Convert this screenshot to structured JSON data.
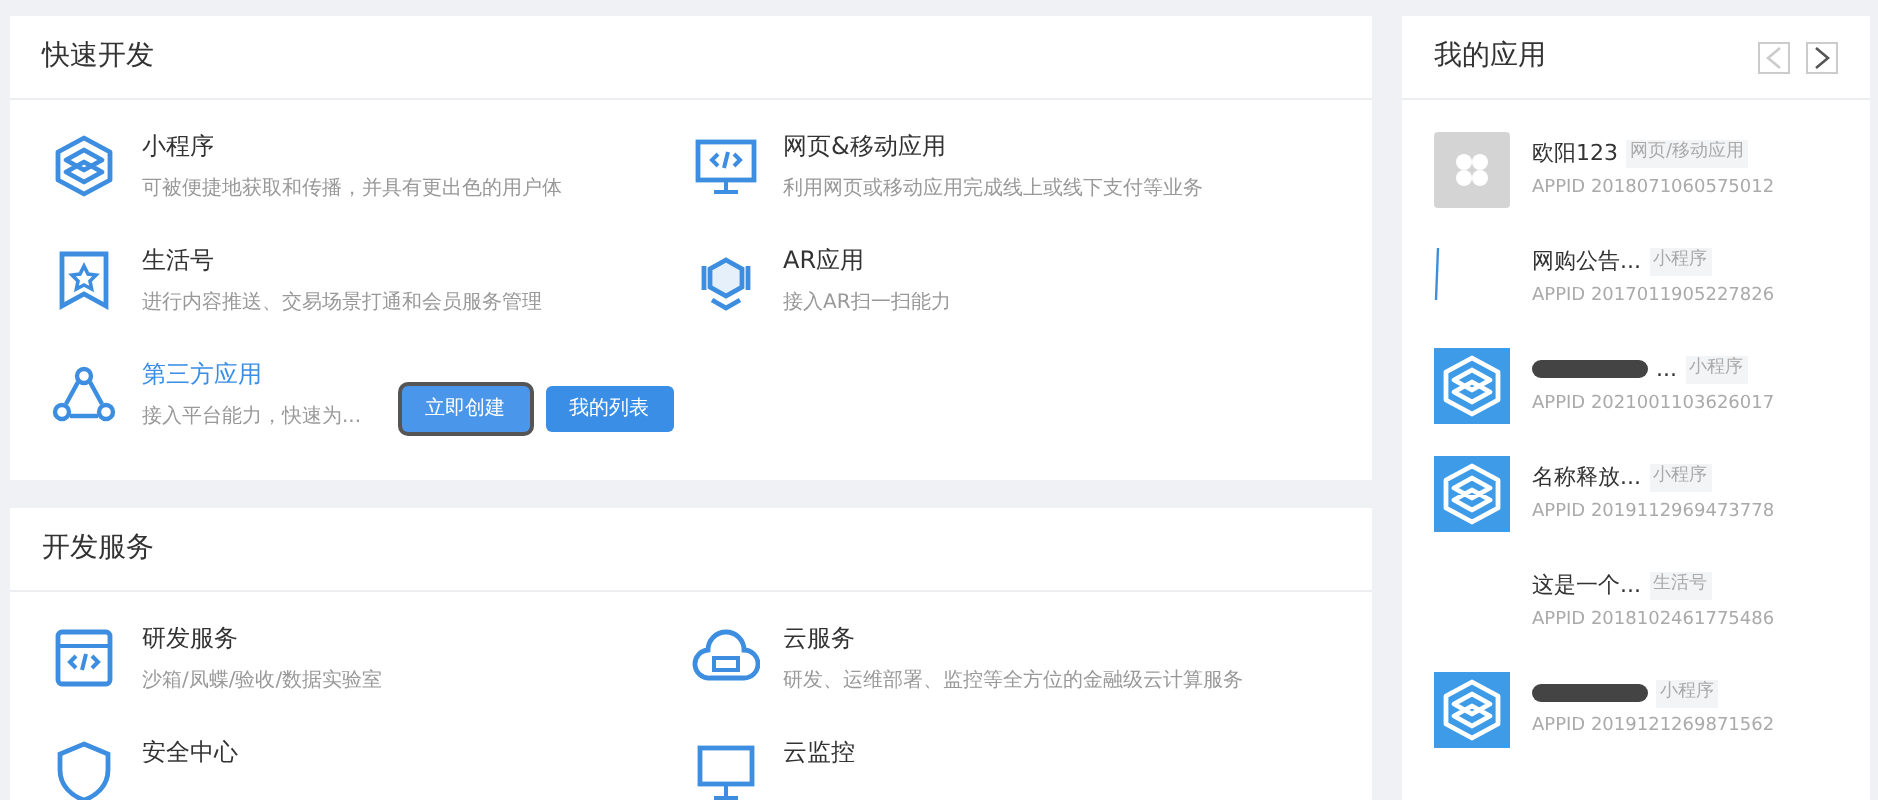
{
  "quick_dev": {
    "title": "快速开发",
    "items": [
      {
        "title": "小程序",
        "desc": "可被便捷地获取和传播，并具有更出色的用户体",
        "link": false
      },
      {
        "title": "网页&移动应用",
        "desc": "利用网页或移动应用完成线上或线下支付等业务",
        "link": false
      },
      {
        "title": "生活号",
        "desc": "进行内容推送、交易场景打通和会员服务管理",
        "link": false
      },
      {
        "title": "AR应用",
        "desc": "接入AR扫一扫能力",
        "link": false
      },
      {
        "title": "第三方应用",
        "desc": "接入平台能力，快速为...",
        "link": true,
        "buttons": [
          {
            "label": "立即创建",
            "focused": true
          },
          {
            "label": "我的列表",
            "focused": false
          }
        ]
      }
    ]
  },
  "dev_services": {
    "title": "开发服务",
    "items": [
      {
        "title": "研发服务",
        "desc": "沙箱/凤蝶/验收/数据实验室"
      },
      {
        "title": "云服务",
        "desc": "研发、运维部署、监控等全方位的金融级云计算服务"
      },
      {
        "title": "安全中心"
      },
      {
        "title": "云监控"
      }
    ]
  },
  "my_apps": {
    "title": "我的应用",
    "apps": [
      {
        "kind": "grey",
        "name": "欧阳123",
        "tag": "网页/移动应用",
        "appid": "APPID 2018071060575012",
        "redacted": false
      },
      {
        "kind": "broken",
        "name": "网购公告...",
        "tag": "小程序",
        "appid": "APPID 2017011905227826",
        "redacted": false
      },
      {
        "kind": "logo",
        "name": "...",
        "tag": "小程序",
        "appid": "APPID 2021001103626017",
        "redacted": true
      },
      {
        "kind": "logo",
        "name": "名称释放...",
        "tag": "小程序",
        "appid": "APPID 2019112969473778",
        "redacted": false
      },
      {
        "kind": "none",
        "name": "这是一个...",
        "tag": "生活号",
        "appid": "APPID 2018102461775486",
        "redacted": false
      },
      {
        "kind": "logo",
        "tag": "小程序",
        "appid": "APPID 2019121269871562",
        "redacted": true
      }
    ]
  }
}
